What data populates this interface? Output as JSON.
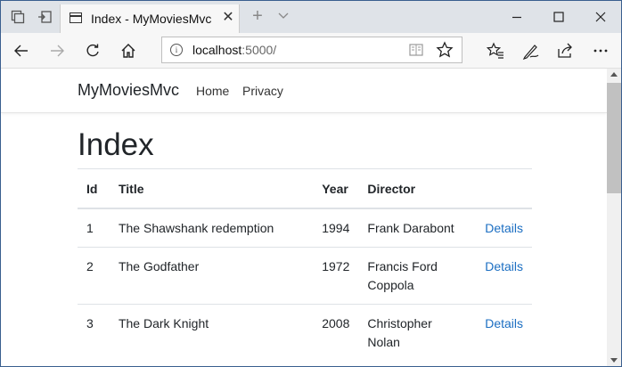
{
  "browser": {
    "tab_title": "Index - MyMoviesMvc",
    "url_host": "localhost",
    "url_rest": ":5000/",
    "tab_close": "✕",
    "new_tab": "+",
    "tab_list": "⌄",
    "window_controls": {
      "minimize": "–",
      "maximize": "☐",
      "close": "✕"
    }
  },
  "site": {
    "brand": "MyMoviesMvc",
    "nav": [
      "Home",
      "Privacy"
    ]
  },
  "page": {
    "heading": "Index",
    "columns": [
      "Id",
      "Title",
      "Year",
      "Director",
      ""
    ],
    "rows": [
      {
        "id": "1",
        "title": "The Shawshank redemption",
        "year": "1994",
        "director": "Frank Darabont",
        "link": "Details"
      },
      {
        "id": "2",
        "title": "The Godfather",
        "year": "1972",
        "director": "Francis Ford Coppola",
        "link": "Details"
      },
      {
        "id": "3",
        "title": "The Dark Knight",
        "year": "2008",
        "director": "Christopher Nolan",
        "link": "Details"
      }
    ]
  },
  "icons": [
    "tab-actions-icon",
    "set-aside-tabs-icon",
    "page-icon",
    "back-icon",
    "forward-icon",
    "refresh-icon",
    "home-icon",
    "site-info-icon",
    "reading-view-icon",
    "favorite-star-icon",
    "favorites-hub-icon",
    "pen-icon",
    "share-icon",
    "more-icon"
  ],
  "colors": {
    "link": "#1b6ec2",
    "tabbar": "#dfe3e8",
    "toolbar": "#f7f7f7"
  }
}
